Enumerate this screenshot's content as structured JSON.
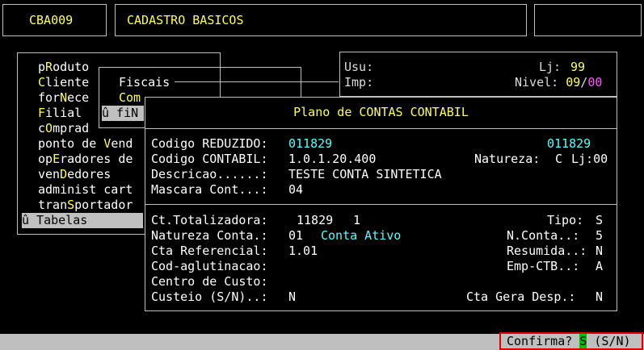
{
  "header": {
    "code": "CBA009",
    "title": "CADASTRO BASICOS"
  },
  "user_panel": {
    "usu_label": "Usu:",
    "lj_label": "Lj:",
    "lj_value": "99",
    "imp_label": "Imp:",
    "nivel_label": "Nivel:",
    "nivel_value": "09",
    "nivel_sep": "/",
    "nivel_total": "00"
  },
  "menu": {
    "items": [
      {
        "pre": "p",
        "hot": "R",
        "post": "oduto"
      },
      {
        "pre": "",
        "hot": "C",
        "post": "liente"
      },
      {
        "pre": "for",
        "hot": "N",
        "post": "ece"
      },
      {
        "pre": "",
        "hot": "F",
        "post": "ilial"
      },
      {
        "pre": "c",
        "hot": "O",
        "post": "mprad"
      },
      {
        "pre": "ponto de ",
        "hot": "V",
        "post": "end"
      },
      {
        "pre": "op",
        "hot": "E",
        "post": "radores de"
      },
      {
        "pre": "ven",
        "hot": "D",
        "post": "edores"
      },
      {
        "pre": "administ cart",
        "hot": "",
        "post": ""
      },
      {
        "pre": "tran",
        "hot": "S",
        "post": "portador"
      }
    ],
    "selected": "û Tabelas"
  },
  "submenu": {
    "fiscais": "Fiscais",
    "com": "Com",
    "fin": "û fiN"
  },
  "dialog": {
    "title": "Plano de CONTAS CONTABIL",
    "codigo_reduzido_label": "Codigo REDUZIDO:",
    "codigo_reduzido": "011829",
    "codigo_reduzido_right": "011829",
    "codigo_contabil_label": "Codigo CONTABIL:",
    "codigo_contabil": "1.0.1.20.400",
    "natureza_label": "Natureza:",
    "natureza_value": "C",
    "natureza_lj": "Lj:00",
    "descricao_label": "Descricao......:",
    "descricao": "TESTE CONTA SINTETICA",
    "mascara_label": "Mascara Cont...:",
    "mascara": "04",
    "ct_totalizadora_label": "Ct.Totalizadora:",
    "ct_totalizadora": "11829",
    "ct_totalizadora_level": "1",
    "tipo_label": "Tipo:",
    "tipo": "S",
    "natureza_conta_label": "Natureza Conta.:",
    "natureza_conta_code": "01",
    "natureza_conta_desc": "Conta Ativo",
    "n_conta_label": "N.Conta..:",
    "n_conta": "5",
    "cta_referencial_label": "Cta Referencial:",
    "cta_referencial": "1.01",
    "resumida_label": "Resumida..:",
    "resumida": "N",
    "cod_aglutinacao_label": "Cod-aglutinacao:",
    "emp_ctb_label": "Emp-CTB..:",
    "emp_ctb": "A",
    "centro_custo_label": "Centro de Custo:",
    "custeio_label": "Custeio (S/N)..:",
    "custeio": "N",
    "cta_gera_desp_label": "Cta Gera Desp.:",
    "cta_gera_desp": "N"
  },
  "prompt": {
    "label": "Confirma? ",
    "answer": "S",
    "options": " (S/N)"
  }
}
